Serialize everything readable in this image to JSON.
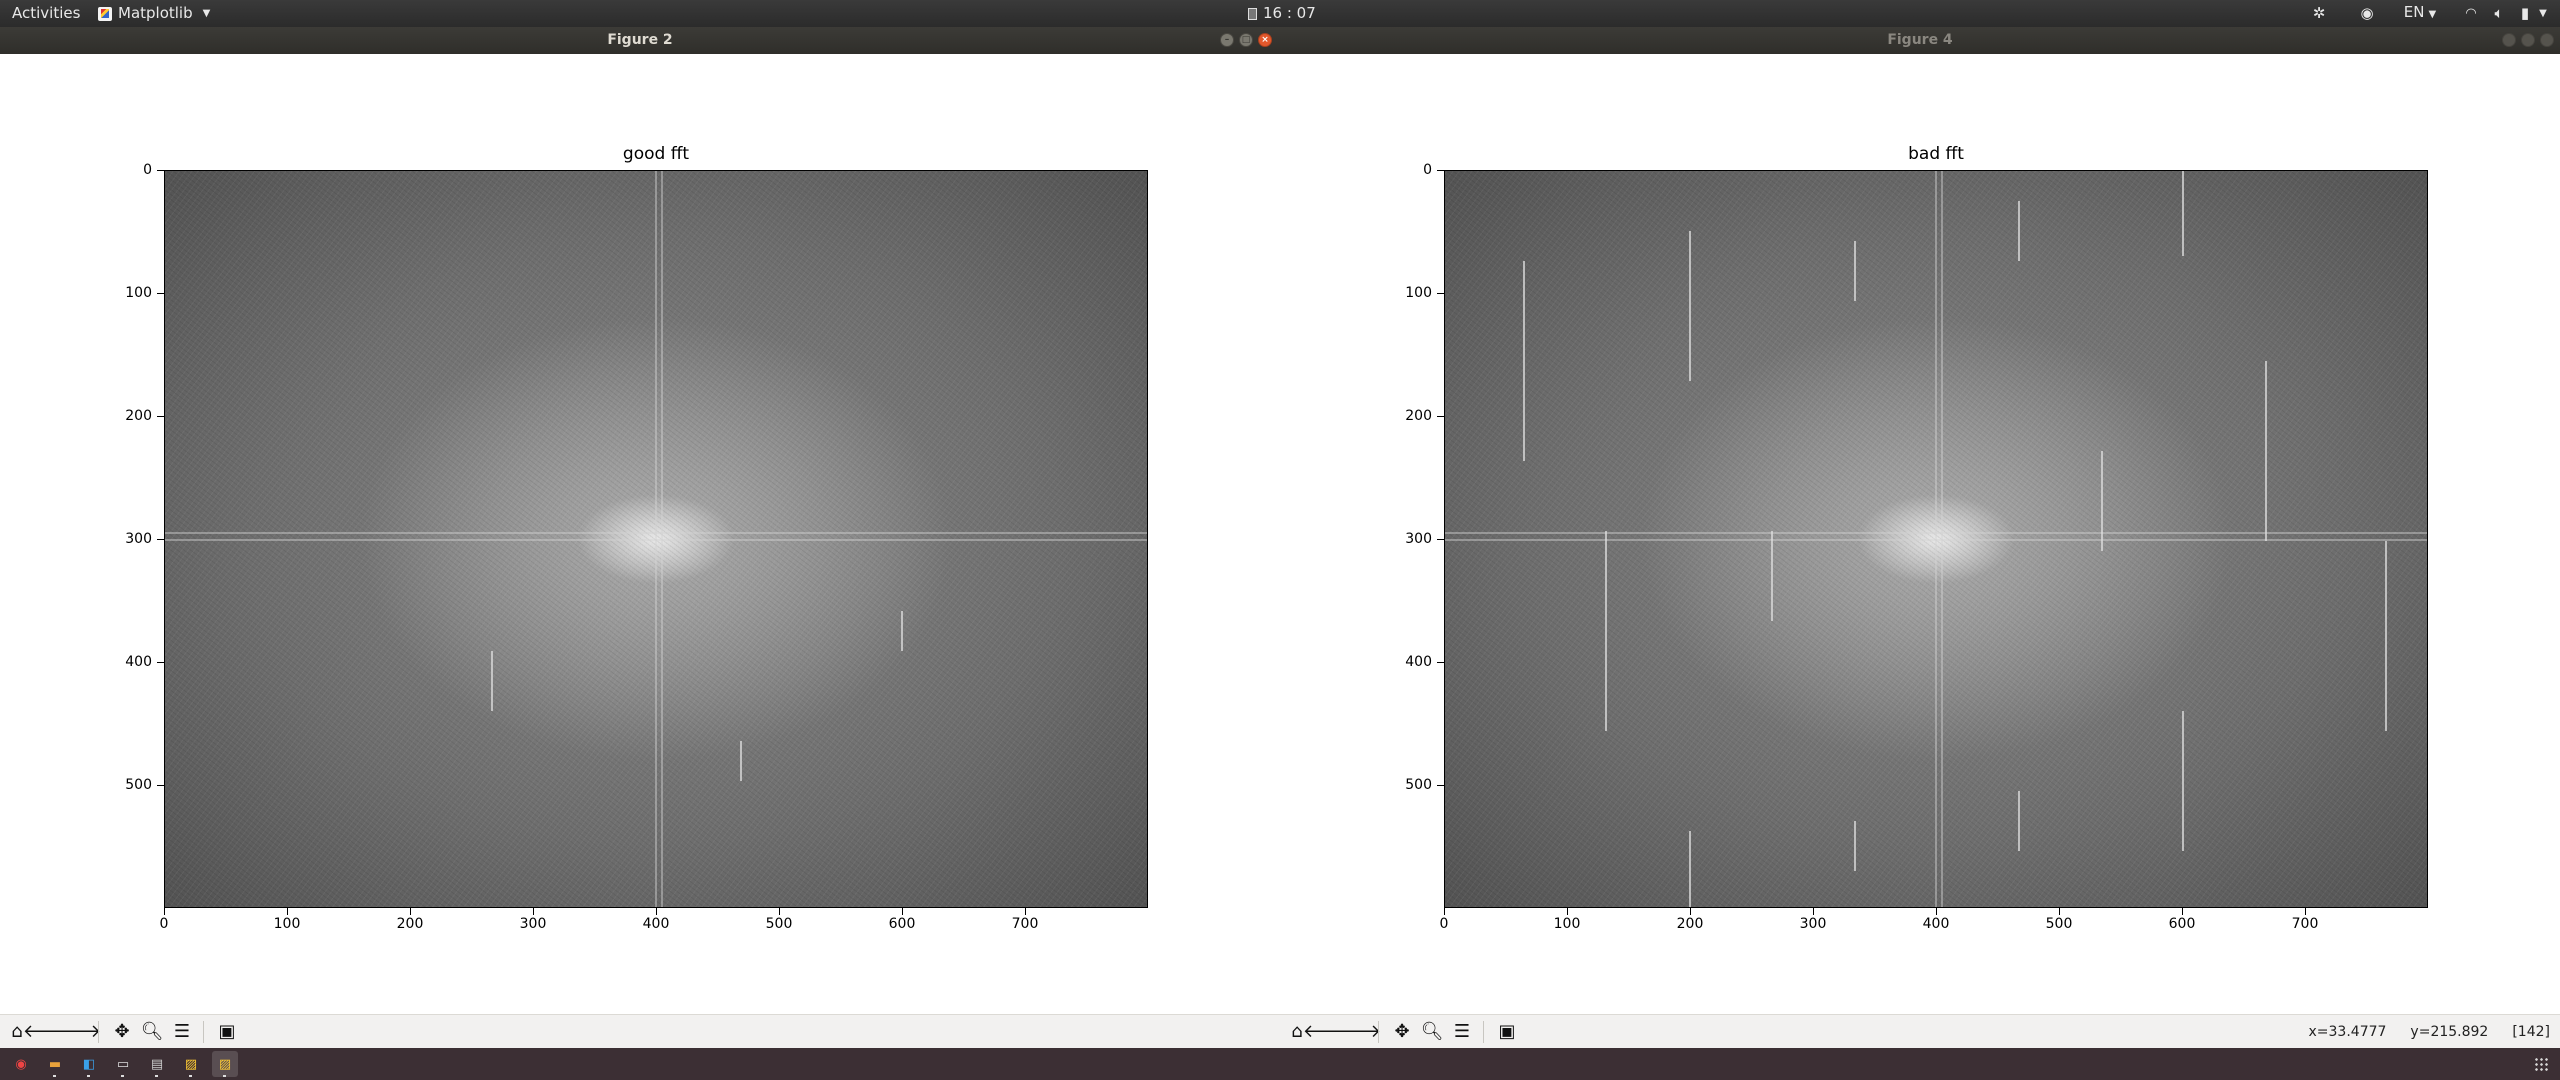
{
  "topbar": {
    "activities": "Activities",
    "app_name": "Matplotlib",
    "clock": "16 : 07",
    "language": "EN"
  },
  "windows": [
    {
      "title": "Figure 2",
      "state": "active"
    },
    {
      "title": "Figure 4",
      "state": "inactive"
    }
  ],
  "plots": [
    {
      "title": "good fft",
      "y_ticks": [
        "0",
        "100",
        "200",
        "300",
        "400",
        "500"
      ],
      "x_ticks": [
        "0",
        "100",
        "200",
        "300",
        "400",
        "500",
        "600",
        "700"
      ]
    },
    {
      "title": "bad fft",
      "y_ticks": [
        "0",
        "100",
        "200",
        "300",
        "400",
        "500"
      ],
      "x_ticks": [
        "0",
        "100",
        "200",
        "300",
        "400",
        "500",
        "600",
        "700"
      ]
    }
  ],
  "toolbar": {
    "icons": [
      "home-icon",
      "back-arrow-icon",
      "forward-arrow-icon",
      "pan-icon",
      "zoom-icon",
      "configure-subplots-icon",
      "save-icon"
    ]
  },
  "status": {
    "x": "x=33.4777",
    "y": "y=215.892",
    "value": "[142]"
  },
  "dock": {
    "apps": [
      "chrome-icon",
      "files-icon",
      "vscode-icon",
      "terminal-icon",
      "image-viewer-icon",
      "matplotlib-icon",
      "matplotlib-icon"
    ]
  },
  "colors": {
    "topbar": "#2b2b2b",
    "titlebar": "#3c3b37",
    "close_button": "#e2582c",
    "toolbar_bg": "#f2f1f0",
    "dock_bg": "#3c2f34"
  }
}
